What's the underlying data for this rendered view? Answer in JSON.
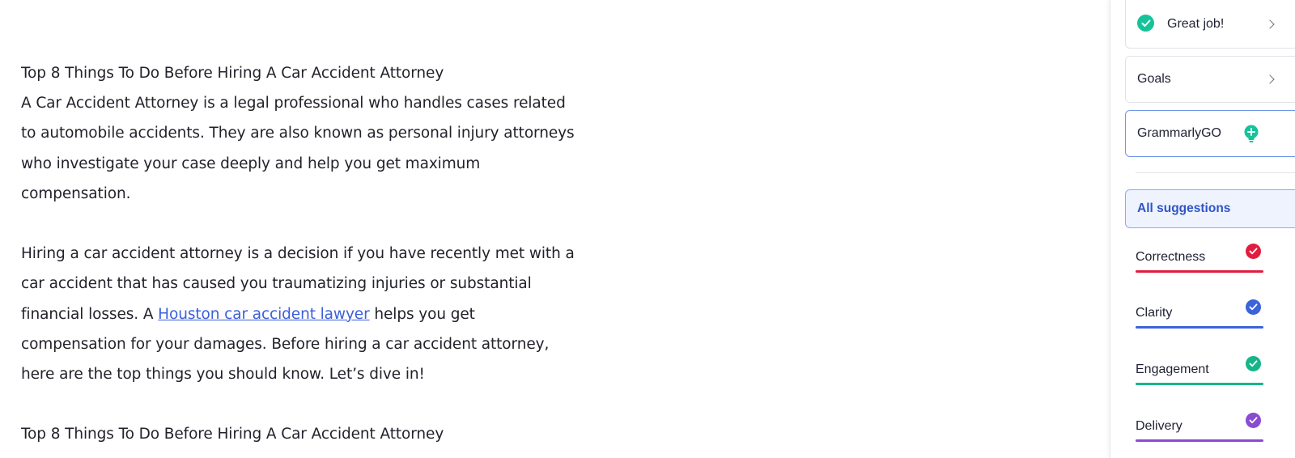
{
  "editor": {
    "heading1": "Top 8 Things To Do Before Hiring A Car Accident Attorney",
    "para1_lines": [
      "A Car Accident Attorney is a legal professional who handles cases related",
      "to automobile accidents. They are also known as personal injury attorneys",
      "who investigate your case deeply and help you get maximum",
      "compensation."
    ],
    "para2_line1": "Hiring a car accident attorney is a decision if you have recently met with a",
    "para2_line2": "car accident that has caused you traumatizing injuries or substantial",
    "para2_line3_before": "financial losses. A ",
    "para2_link": "Houston car accident lawyer",
    "para2_line3_after": " helps you get",
    "para2_line4": "compensation for your damages. Before hiring a car accident attorney,",
    "para2_line5": "here are the top things you should know. Let’s dive in!",
    "heading2": "Top 8 Things To Do Before Hiring A Car Accident Attorney"
  },
  "panel": {
    "great_job": {
      "label": "Great job!",
      "icon": "check-circle-icon",
      "color": "#15c39a"
    },
    "goals": {
      "label": "Goals"
    },
    "grammarlygo": {
      "label": "GrammarlyGO",
      "icon": "bulb-plus-icon",
      "color": "#15c39a"
    },
    "all_suggestions": {
      "label": "All suggestions"
    },
    "categories": [
      {
        "label": "Correctness",
        "color": "#e11d3f",
        "icon": "check-circle-icon"
      },
      {
        "label": "Clarity",
        "color": "#3c63d8",
        "icon": "check-circle-icon"
      },
      {
        "label": "Engagement",
        "color": "#16b58a",
        "icon": "check-circle-icon"
      },
      {
        "label": "Delivery",
        "color": "#8a4bd1",
        "icon": "check-circle-icon"
      }
    ]
  }
}
